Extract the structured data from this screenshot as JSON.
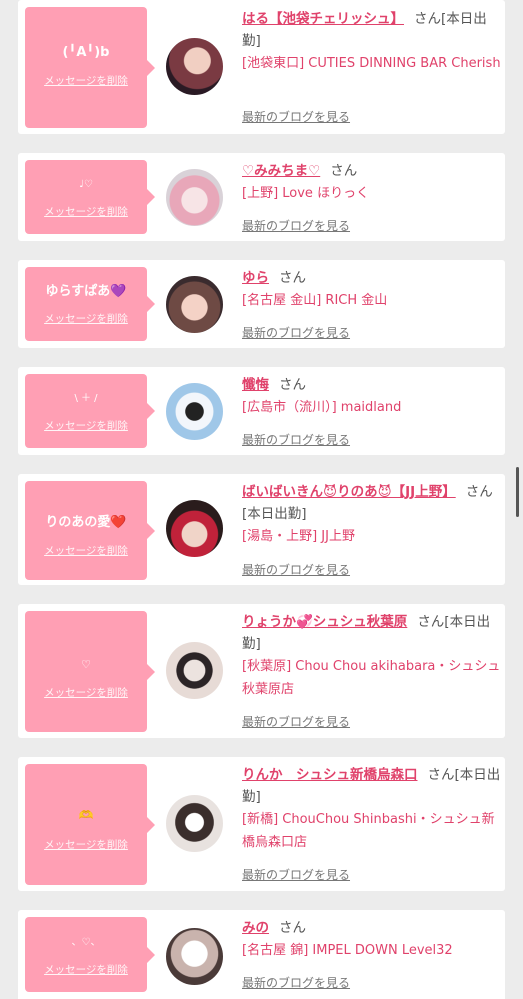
{
  "entries": [
    {
      "message": "(╹A╹)b",
      "delete_label": "メッセージを削除",
      "name": "はる【池袋チェリッシュ】",
      "honorific": "さん[本日出勤]",
      "shop": "[池袋東口] CUTIES DINNING BAR Cherish",
      "blog_label": "最新のブログを見る"
    },
    {
      "message": "♩♡",
      "delete_label": "メッセージを削除",
      "name": "♡みみちま♡",
      "honorific": "さん",
      "shop": "[上野] Love ほりっく",
      "blog_label": "最新のブログを見る"
    },
    {
      "message": "ゆらすぱあ💜",
      "delete_label": "メッセージを削除",
      "name": "ゆら",
      "honorific": "さん",
      "shop": "[名古屋 金山] RICH 金山",
      "blog_label": "最新のブログを見る"
    },
    {
      "message": "\\ ＋ /",
      "delete_label": "メッセージを削除",
      "name": "懺悔",
      "honorific": "さん",
      "shop": "[広島市（流川）] maidland",
      "blog_label": "最新のブログを見る"
    },
    {
      "message": "りのあの愛❤️",
      "delete_label": "メッセージを削除",
      "name": "ばいばいきん😈りのあ😈【JJ上野】",
      "honorific": "さん[本日出勤]",
      "shop": "[湯島・上野] JJ上野",
      "blog_label": "最新のブログを見る"
    },
    {
      "message": "♡",
      "delete_label": "メッセージを削除",
      "name": "りょうか💞シュシュ秋葉原",
      "honorific": "さん[本日出勤]",
      "shop": "[秋葉原] Chou Chou akihabara・シュシュ秋葉原店",
      "blog_label": "最新のブログを見る"
    },
    {
      "message": "🫶",
      "delete_label": "メッセージを削除",
      "name": "りんか　シュシュ新橋烏森口",
      "honorific": "さん[本日出勤]",
      "shop": "[新橋] ChouChou Shinbashi・シュシュ新橋烏森口店",
      "blog_label": "最新のブログを見る"
    },
    {
      "message": "、♡、",
      "delete_label": "メッセージを削除",
      "name": "みの",
      "honorific": "さん",
      "shop": "[名古屋 錦] IMPEL DOWN Level32",
      "blog_label": "最新のブログを見る"
    }
  ],
  "colors": {
    "accent": "#e0426b",
    "bubble": "#ff9fb4",
    "background": "#ececec"
  }
}
